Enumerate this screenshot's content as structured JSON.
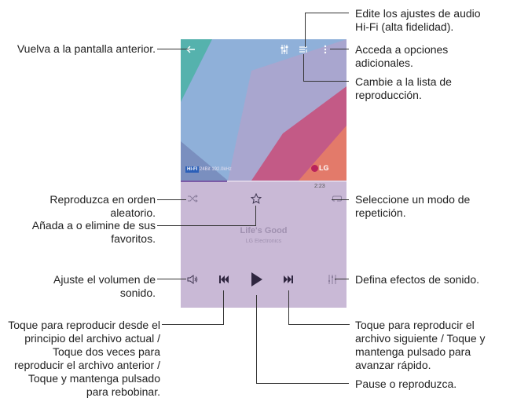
{
  "player": {
    "song_title": "Life's Good",
    "song_artist": "LG Electronics",
    "elapsed_time": "2:23",
    "hifi_badge": "HI-FI",
    "hifi_meta": "24Bit 192.0kHz",
    "brand_logo": "LG",
    "progress_fraction": 0.28
  },
  "callouts": {
    "back": "Vuelva a la pantalla anterior.",
    "shuffle": "Reproduzca en orden aleatorio.",
    "favorites": "Añada a o elimine de sus favoritos.",
    "volume": "Ajuste el volumen de sonido.",
    "previous": "Toque para reproducir desde el principio del archivo actual / Toque dos veces para reproducir el archivo anterior / Toque y mantenga pulsado para rebobinar.",
    "hifi": "Edite los ajustes de audio Hi-Fi (alta fidelidad).",
    "more_options": "Acceda a opciones adicionales.",
    "playlist": "Cambie a la lista de reproducción.",
    "repeat": "Seleccione un modo de repetición.",
    "sound_effects": "Defina efectos de sonido.",
    "next": "Toque para reproducir el archivo siguiente / Toque y mantenga pulsado para avanzar rápido.",
    "play_pause": "Pause o reproduzca."
  },
  "colors": {
    "accent": "#7b5aa6",
    "panel": "#c9b9d6"
  },
  "icons": [
    "back-arrow-icon",
    "hifi-settings-icon",
    "playlist-icon",
    "more-options-icon",
    "shuffle-icon",
    "star-icon",
    "repeat-icon",
    "volume-icon",
    "previous-icon",
    "play-icon",
    "next-icon",
    "sound-effects-icon"
  ]
}
